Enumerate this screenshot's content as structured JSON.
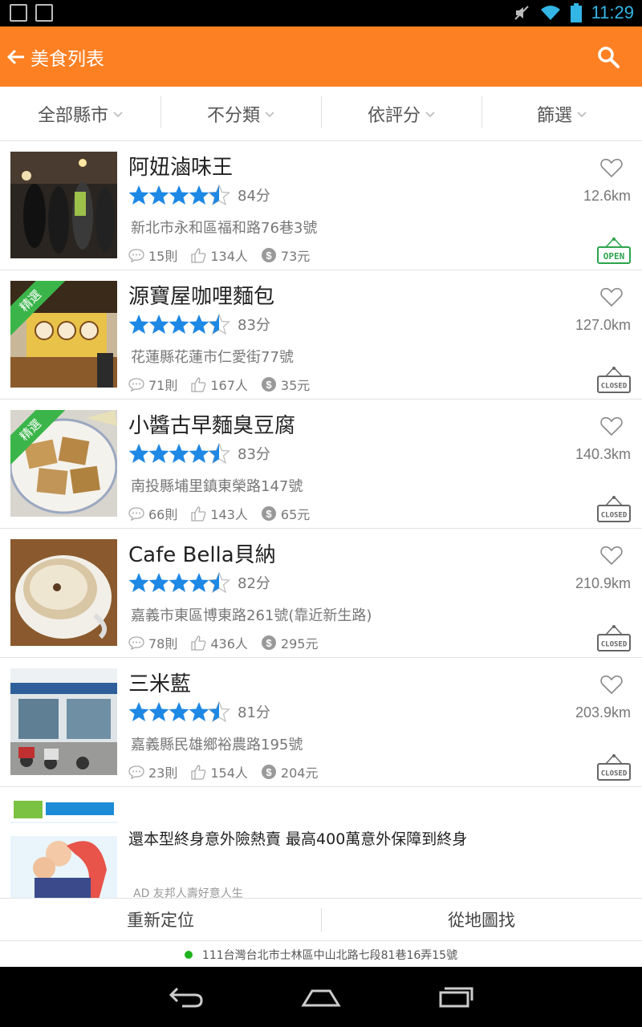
{
  "status": {
    "time": "11:29"
  },
  "appbar": {
    "title": "美食列表"
  },
  "filters": [
    {
      "label": "全部縣市"
    },
    {
      "label": "不分類"
    },
    {
      "label": "依評分"
    },
    {
      "label": "篩選"
    }
  ],
  "items": [
    {
      "name": "阿妞滷味王",
      "rating": 4.5,
      "score": "84分",
      "address": "新北市永和區福和路76巷3號",
      "comments": "15則",
      "likes": "134人",
      "price": "73元",
      "distance": "12.6km",
      "status": "OPEN",
      "featured": false,
      "featured_label": ""
    },
    {
      "name": "源寶屋咖哩麵包",
      "rating": 4.5,
      "score": "83分",
      "address": "花蓮縣花蓮市仁愛街77號",
      "comments": "71則",
      "likes": "167人",
      "price": "35元",
      "distance": "127.0km",
      "status": "CLOSED",
      "featured": true,
      "featured_label": "精選"
    },
    {
      "name": "小醬古早麵臭豆腐",
      "rating": 4.5,
      "score": "83分",
      "address": "南投縣埔里鎮東榮路147號",
      "comments": "66則",
      "likes": "143人",
      "price": "65元",
      "distance": "140.3km",
      "status": "CLOSED",
      "featured": true,
      "featured_label": "精選"
    },
    {
      "name": "Cafe  Bella貝納",
      "rating": 4.5,
      "score": "82分",
      "address": "嘉義市東區博東路261號(靠近新生路)",
      "comments": "78則",
      "likes": "436人",
      "price": "295元",
      "distance": "210.9km",
      "status": "CLOSED",
      "featured": false,
      "featured_label": ""
    },
    {
      "name": "三米藍",
      "rating": 4.5,
      "score": "81分",
      "address": "嘉義縣民雄鄉裕農路195號",
      "comments": "23則",
      "likes": "154人",
      "price": "204元",
      "distance": "203.9km",
      "status": "CLOSED",
      "featured": false,
      "featured_label": ""
    }
  ],
  "ad": {
    "text": "還本型終身意外險熱賣 最高400萬意外保障到終身",
    "sponsor": "AD  友邦人壽好意人生"
  },
  "bottom": {
    "relocate": "重新定位",
    "map": "從地圖找"
  },
  "location": "111台灣台北市士林區中山北路七段81巷16弄15號",
  "colors": {
    "accent": "#fd8023",
    "star": "#1e88e5",
    "featured": "#3bb54a",
    "open": "#2ca44b",
    "closed": "#666666"
  }
}
